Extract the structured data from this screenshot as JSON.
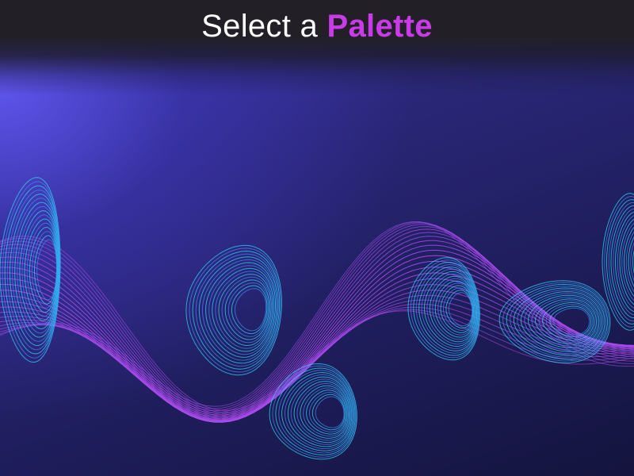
{
  "header": {
    "title_prefix": "Select a",
    "title_highlight": "Palette",
    "highlight_color": "#c93be8"
  },
  "colors": {
    "wave_cyan": "#2fd3f0",
    "wave_blue": "#3a86f0",
    "wave_violet": "#a04ef0",
    "wave_magenta": "#c044e8"
  }
}
